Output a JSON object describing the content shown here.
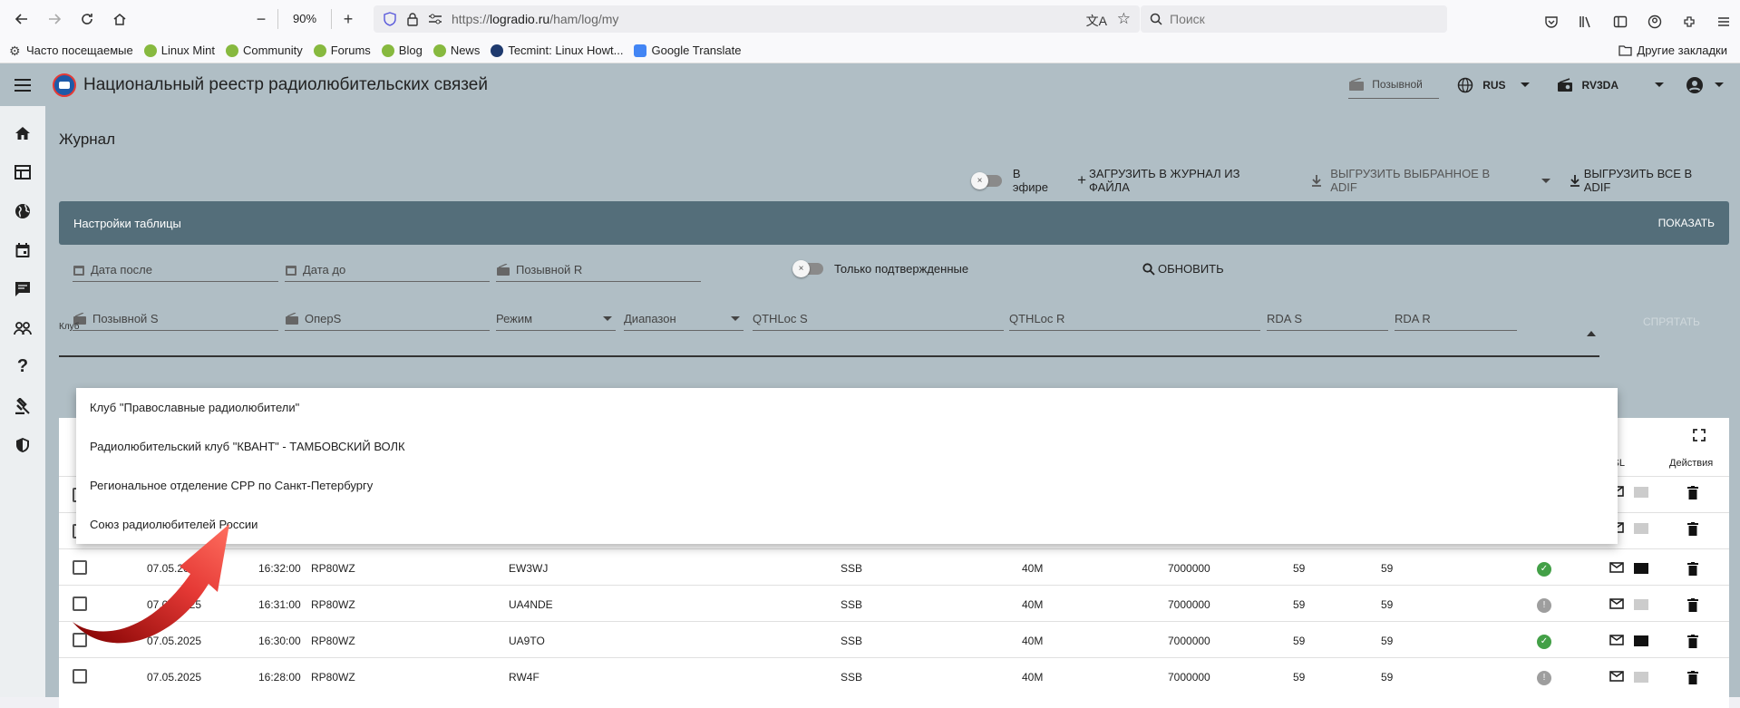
{
  "browser": {
    "zoom": "90%",
    "url_prefix": "https://",
    "url_domain": "logradio.ru",
    "url_path": "/ham/log/my",
    "search_placeholder": "Поиск"
  },
  "bookmarks": {
    "items": [
      {
        "label": "Часто посещаемые",
        "icon": "gear-icon",
        "color": "#444444"
      },
      {
        "label": "Linux Mint",
        "icon": "mint-icon",
        "color": "#87b93f"
      },
      {
        "label": "Community",
        "icon": "mint-icon",
        "color": "#87b93f"
      },
      {
        "label": "Forums",
        "icon": "mint-icon",
        "color": "#87b93f"
      },
      {
        "label": "Blog",
        "icon": "mint-icon",
        "color": "#87b93f"
      },
      {
        "label": "News",
        "icon": "mint-icon",
        "color": "#87b93f"
      },
      {
        "label": "Tecmint: Linux Howt...",
        "icon": "tecmint-icon",
        "color": "#1f3a6e"
      },
      {
        "label": "Google Translate",
        "icon": "translate-icon",
        "color": "#4285f4"
      }
    ],
    "other": "Другие закладки"
  },
  "app": {
    "title": "Национальный реестр радиолюбительских связей",
    "callsign_button": "Позывной",
    "language": "RUS",
    "station": "RV3DA"
  },
  "page": {
    "title": "Журнал",
    "on_air_label": "В эфире",
    "upload_button": "ЗАГРУЗИТЬ В ЖУРНАЛ ИЗ ФАЙЛА",
    "export_selected_button": "ВЫГРУЗИТЬ ВЫБРАННОЕ В ADIF",
    "export_all_button": "ВЫГРУЗИТЬ ВСЕ В ADIF",
    "settings_title": "Настройки таблицы",
    "show_button": "ПОКАЗАТЬ"
  },
  "filters": {
    "date_after": "Дата после",
    "date_before": "Дата до",
    "callsign_r": "Позывной R",
    "confirmed_only": "Только подтвержденные",
    "refresh_button": "ОБНОВИТЬ",
    "callsign_s": "Позывной S",
    "oper_s": "ОперS",
    "mode": "Режим",
    "band": "Диапазон",
    "qthloc_s": "QTHLoc S",
    "qthloc_r": "QTHLoc R",
    "rda_s": "RDA S",
    "rda_r": "RDA R",
    "hide_button": "СПРЯТАТЬ",
    "club_label": "Клуб"
  },
  "club_options": [
    "Клуб \"Православные радиолюбители\"",
    "Радиолюбительский клуб \"КВАНТ\" - ТАМБОВСКИЙ ВОЛК",
    "Региональное отделение СРР по Санкт-Петербургу",
    "Союз радиолюбителей России"
  ],
  "table": {
    "headers": {
      "qsl": "QSL",
      "actions": "Действия"
    },
    "rows": [
      {
        "date": "07.05.2025",
        "time": "16:32:00",
        "call_s": "RP80WZ",
        "call_r": "EW3WJ",
        "mode": "SSB",
        "band": "40M",
        "freq": "7000000",
        "rst_s": "59",
        "rst_r": "59",
        "confirmed": true
      },
      {
        "date": "07.05.2025",
        "time": "16:31:00",
        "call_s": "RP80WZ",
        "call_r": "UA4NDE",
        "mode": "SSB",
        "band": "40M",
        "freq": "7000000",
        "rst_s": "59",
        "rst_r": "59",
        "confirmed": false
      },
      {
        "date": "07.05.2025",
        "time": "16:30:00",
        "call_s": "RP80WZ",
        "call_r": "UA9TO",
        "mode": "SSB",
        "band": "40M",
        "freq": "7000000",
        "rst_s": "59",
        "rst_r": "59",
        "confirmed": true
      },
      {
        "date": "07.05.2025",
        "time": "16:28:00",
        "call_s": "RP80WZ",
        "call_r": "RW4F",
        "mode": "SSB",
        "band": "40M",
        "freq": "7000000",
        "rst_s": "59",
        "rst_r": "59",
        "confirmed": false
      }
    ]
  },
  "colors": {
    "header_bg": "#b0bec5",
    "settings_bar": "#546e7a",
    "confirmed": "#43a047",
    "annotation_arrow": "#d32f2f"
  }
}
